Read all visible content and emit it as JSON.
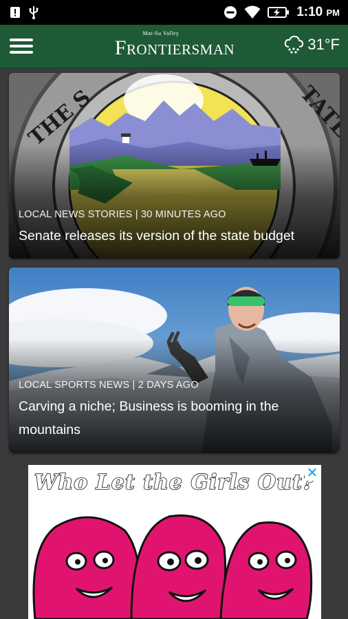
{
  "status_bar": {
    "time": "1:10",
    "ampm": "PM",
    "icons": [
      "alert-icon",
      "usb-icon",
      "do-not-disturb-icon",
      "wifi-icon",
      "battery-charging-icon"
    ]
  },
  "app_bar": {
    "menu_icon": "hamburger-menu-icon",
    "logo_small": "Mat-Su Valley",
    "logo_main": "Frontiersman",
    "weather_icon": "cloud-snow-icon",
    "temperature": "31°F",
    "colors": {
      "bar": "#1f5a36"
    }
  },
  "articles": [
    {
      "meta": "LOCAL NEWS STORIES | 30 MINUTES AGO",
      "title": "Senate releases its version of the state budget",
      "image": "alaska-state-seal-image",
      "seal_text_left": "THE S",
      "seal_text_right": "TATE"
    },
    {
      "meta": "LOCAL SPORTS NEWS | 2 DAYS AGO",
      "title": "Carving a niche; Business is booming in the mountains",
      "image": "skier-mountains-image"
    }
  ],
  "ad": {
    "headline": "Who Let the Girls Out?",
    "close_icon": "close-x-icon",
    "accent": "#e0146e"
  }
}
